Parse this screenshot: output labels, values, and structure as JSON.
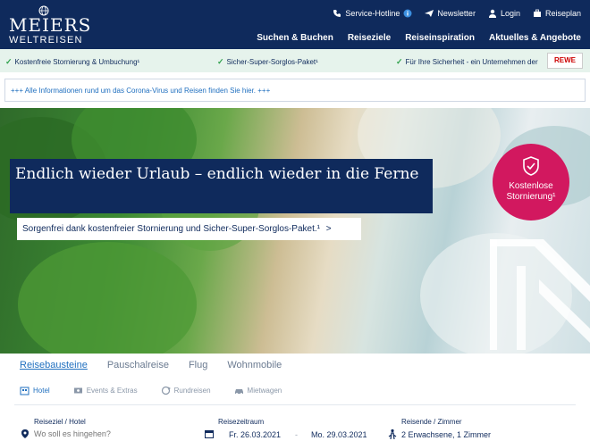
{
  "header": {
    "brand": "MEIERS",
    "brand_sub": "WELTREISEN",
    "utility": {
      "hotline": "Service-Hotline",
      "newsletter": "Newsletter",
      "login": "Login",
      "reiseplan": "Reiseplan"
    },
    "nav": [
      "Suchen & Buchen",
      "Reiseziele",
      "Reiseinspiration",
      "Aktuelles & Angebote"
    ]
  },
  "usp": {
    "items": [
      "Kostenfreie Stornierung & Umbuchung¹",
      "Sicher-Super-Sorglos-Paket¹",
      "Für Ihre Sicherheit - ein Unternehmen der"
    ],
    "partner": "REWE"
  },
  "notice": "+++ Alle Informationen rund um das Corona-Virus und Reisen finden Sie hier. +++",
  "hero": {
    "title": "Endlich wieder Urlaub – endlich wieder in die Ferne",
    "subtitle": "Sorgenfrei dank kostenfreier Stornierung und Sicher-Super-Sorglos-Paket.¹",
    "subtitle_arrow": ">",
    "badge_line1": "Kostenlose",
    "badge_line2": "Stornierung¹"
  },
  "search": {
    "tabs": [
      "Reisebausteine",
      "Pauschalreise",
      "Flug",
      "Wohnmobile"
    ],
    "active_tab": "Reisebausteine",
    "subtabs": [
      "Hotel",
      "Events & Extras",
      "Rundreisen",
      "Mietwagen"
    ],
    "destination_label": "Reiseziel / Hotel",
    "destination_placeholder": "Wo soll es hingehen?",
    "period_label": "Reisezeitraum",
    "date_from": "Fr. 26.03.2021",
    "date_sep": "-",
    "date_to": "Mo. 29.03.2021",
    "travelers_label": "Reisende / Zimmer",
    "travelers_value": "2 Erwachsene,  1 Zimmer"
  },
  "colors": {
    "navy": "#0f2a5c",
    "accent_blue": "#1f6fbf",
    "badge_pink": "#d2185f",
    "usp_green": "#2fa24c",
    "usp_bg": "#e6f3ec"
  },
  "icons": {
    "hotline": "phone-icon",
    "newsletter": "paper-plane-icon",
    "login": "user-icon",
    "reiseplan": "suitcase-icon",
    "badge": "shield-check-icon"
  }
}
